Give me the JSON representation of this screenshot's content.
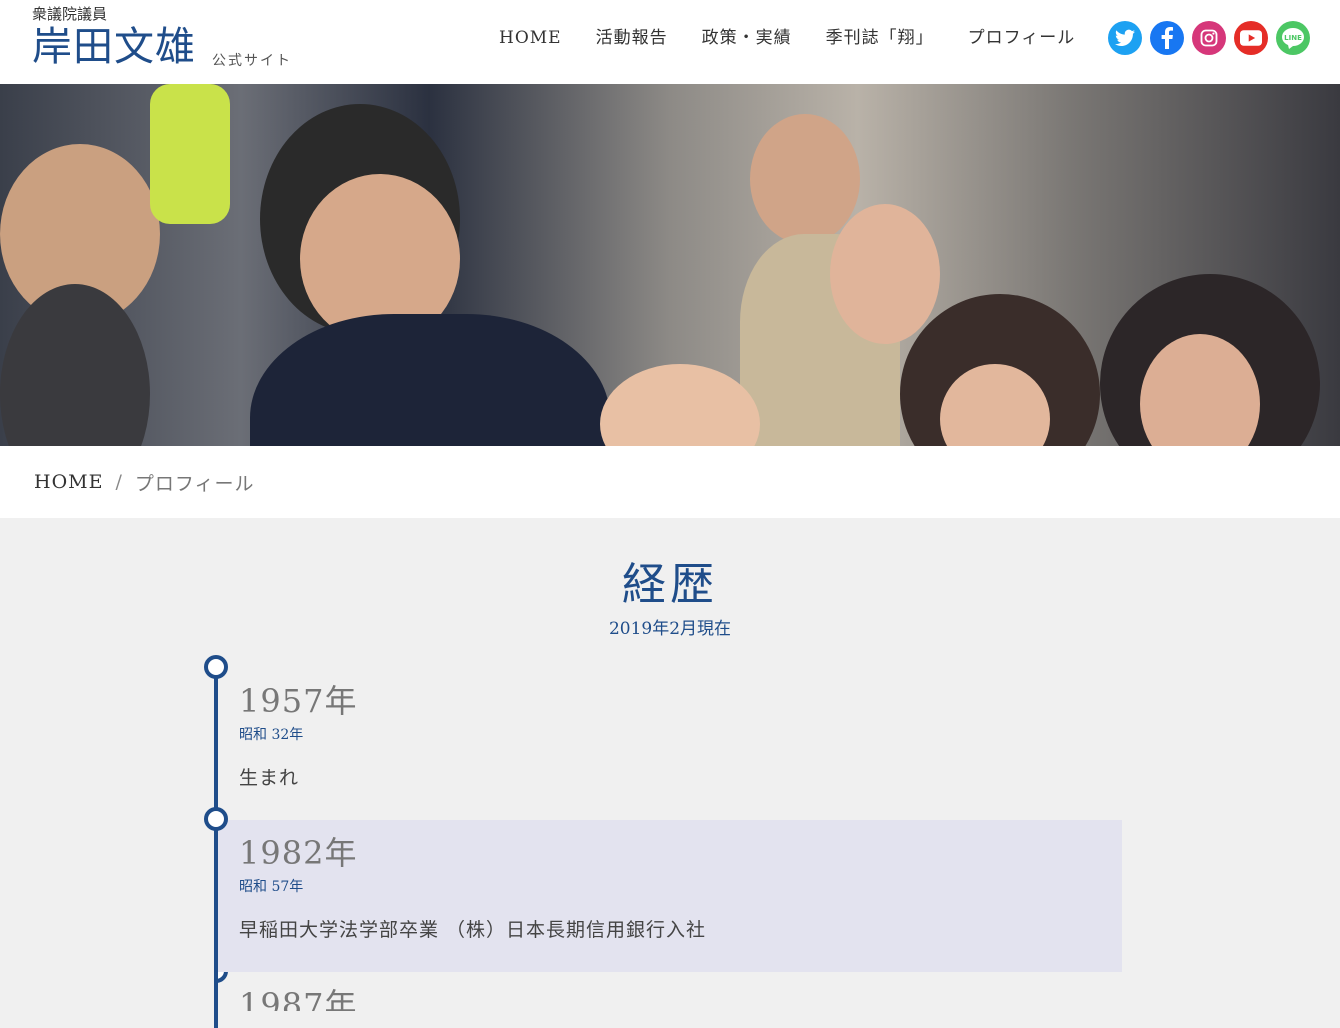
{
  "brand": {
    "kicker": "衆議院議員",
    "name": "岸田文雄",
    "sub": "公式サイト"
  },
  "nav": [
    {
      "label": "HOME"
    },
    {
      "label": "活動報告"
    },
    {
      "label": "政策・実績"
    },
    {
      "label": "季刊誌「翔」"
    },
    {
      "label": "プロフィール"
    }
  ],
  "social": {
    "twitter": "twitter-icon",
    "facebook": "facebook-icon",
    "instagram": "instagram-icon",
    "youtube": "youtube-icon",
    "line": "line-icon",
    "line_text": "LINE"
  },
  "colors": {
    "accent": "#1f4d8a",
    "alt_row": "#e3e3ef"
  },
  "breadcrumb": {
    "home": "HOME",
    "separator": "/",
    "current": "プロフィール"
  },
  "history": {
    "title": "経歴",
    "as_of": "2019年2月現在",
    "items": [
      {
        "year": "1957年",
        "era": "昭和 32年",
        "desc": "生まれ"
      },
      {
        "year": "1982年",
        "era": "昭和 57年",
        "desc": "早稲田大学法学部卒業 （株）日本長期信用銀行入社"
      },
      {
        "year": "1987年",
        "era": "",
        "desc": ""
      }
    ]
  }
}
